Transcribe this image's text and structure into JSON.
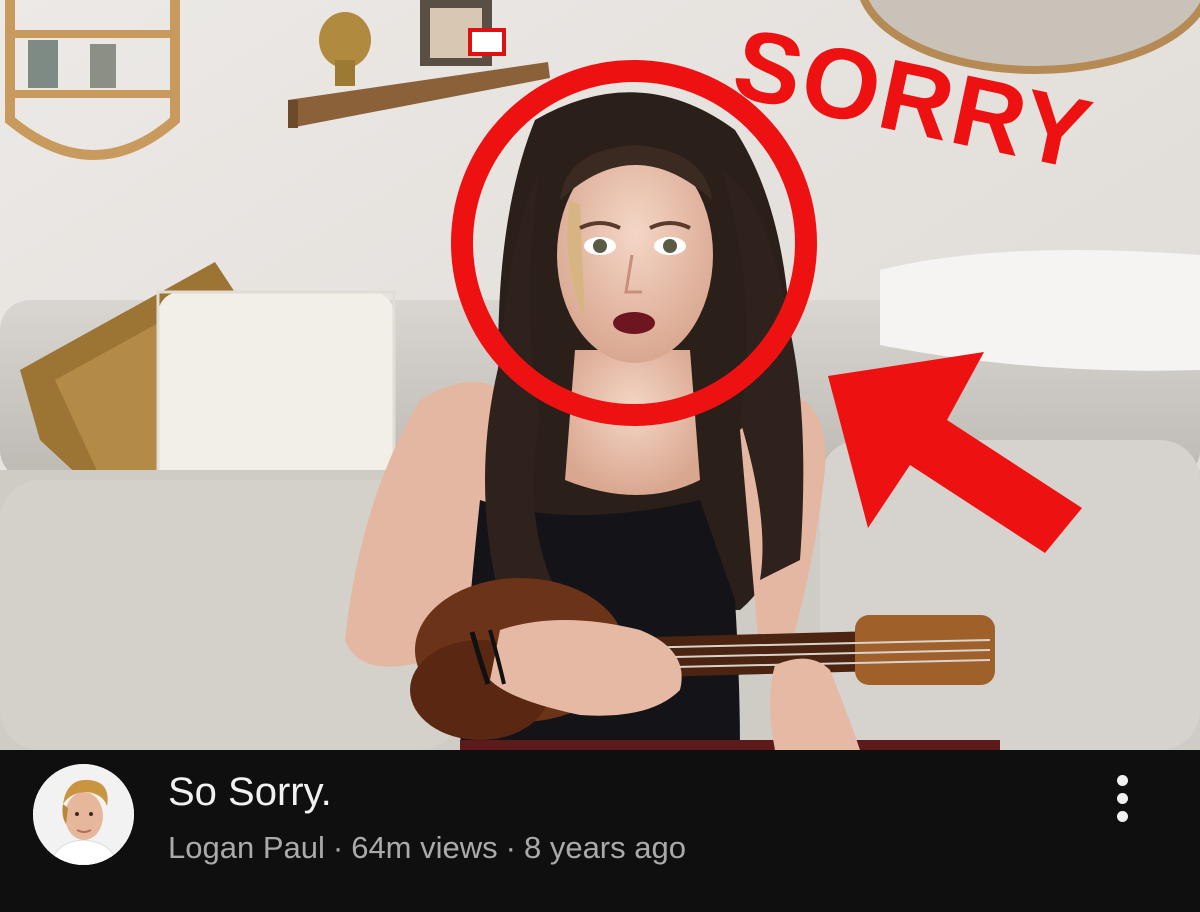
{
  "thumbnail": {
    "overlay_text": "SORRY",
    "accent_color": "#ee1111"
  },
  "video": {
    "title": "So Sorry.",
    "channel": "Logan Paul",
    "views": "64m views",
    "age": "8 years ago",
    "separator": "·"
  },
  "icons": {
    "more": "more-vert-icon",
    "avatar": "channel-avatar"
  }
}
